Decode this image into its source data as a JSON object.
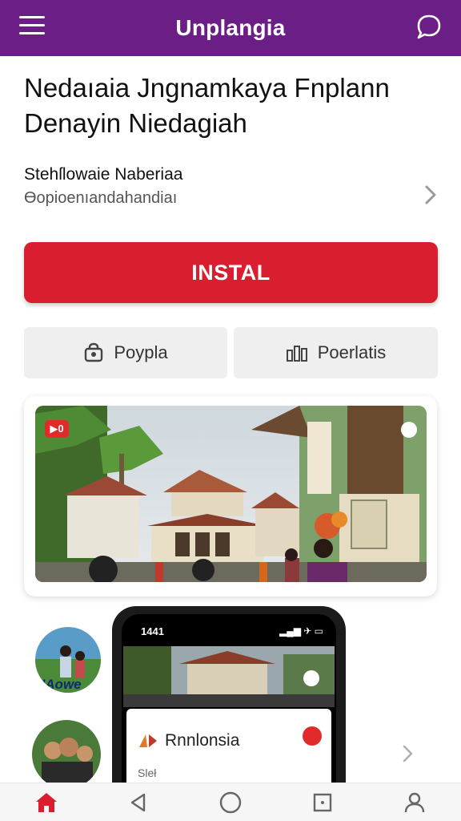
{
  "app": {
    "title": "Unplangia",
    "brand_color": "#6b1f86",
    "accent_color": "#d91f2f"
  },
  "header": {
    "menu_icon": "hamburger-menu-icon",
    "chat_icon": "chat-bubble-icon"
  },
  "listing": {
    "headline_line1": "Nedaıaia Jngnamkaya Fnplann",
    "headline_line2": "Denayin Niedagiah",
    "developer_name": "Stehſlowaie Naberiaa",
    "developer_sub": "Ɵopioenıandahandiaı",
    "install_label": "INSTAL",
    "secondary_left_label": "Poypla",
    "secondary_right_label": "Poerlatis"
  },
  "gallery": {
    "video_badge": "▶0",
    "thumb1_label": "HAowe"
  },
  "phone_preview": {
    "time": "1441",
    "status_icons": "▂▄▆ ✈ ▭",
    "sheet_title": "Rnnlonsia",
    "sheet_sub": "Sleł"
  },
  "bottom_nav": [
    {
      "name": "home",
      "icon": "home-icon"
    },
    {
      "name": "back",
      "icon": "back-triangle-icon"
    },
    {
      "name": "home-circle",
      "icon": "circle-icon"
    },
    {
      "name": "recents",
      "icon": "square-icon"
    },
    {
      "name": "profile",
      "icon": "person-icon"
    }
  ]
}
